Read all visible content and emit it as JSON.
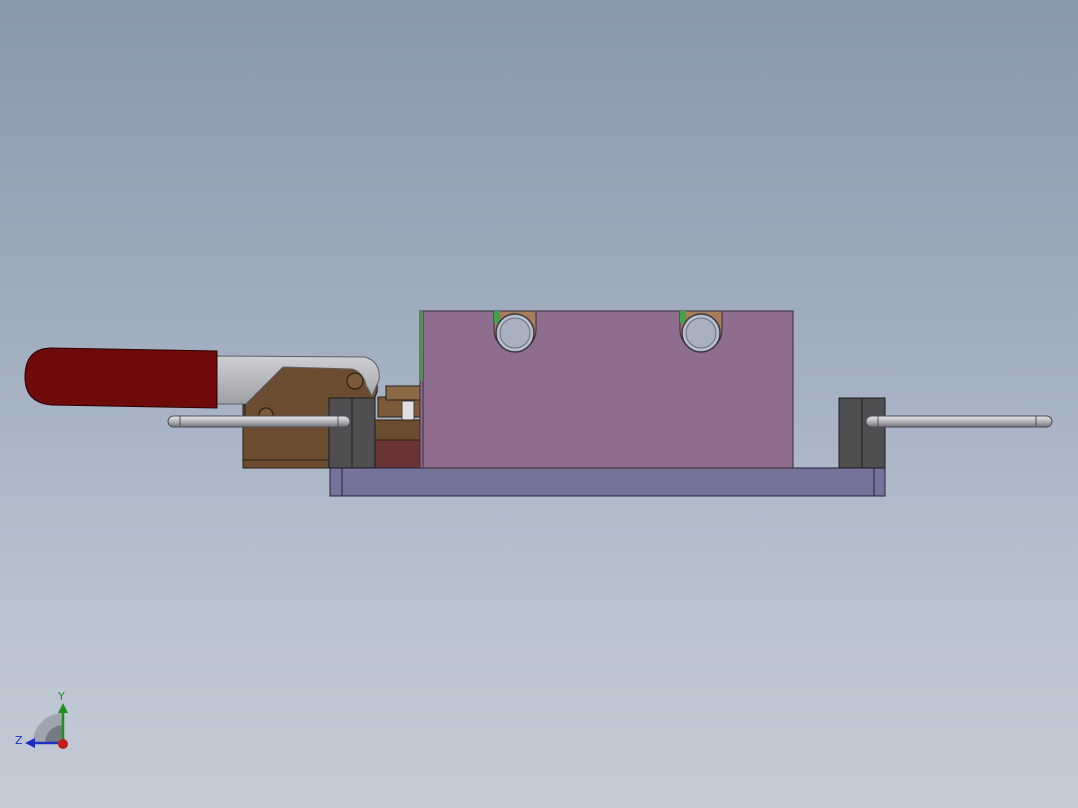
{
  "viewport": {
    "background_top": "#8898ab",
    "background_bottom": "#c4cbd6"
  },
  "model": {
    "parts": {
      "base_plate": {
        "color": "#75739a"
      },
      "mold_block": {
        "color": "#8f6d8e"
      },
      "support_blocks": {
        "color": "#4f4f52"
      },
      "clamp_handle_grip": {
        "color": "#6e0a0a"
      },
      "clamp_body": {
        "color": "#6b4c30"
      },
      "guide_rods": {
        "color": "#9a9ca2"
      }
    },
    "slot_count": 2
  },
  "triad": {
    "y_label": "Y",
    "z_label": "Z",
    "y_color": "#1f8f1f",
    "z_color": "#1f2fbf",
    "x_color": "#c41a1a"
  }
}
